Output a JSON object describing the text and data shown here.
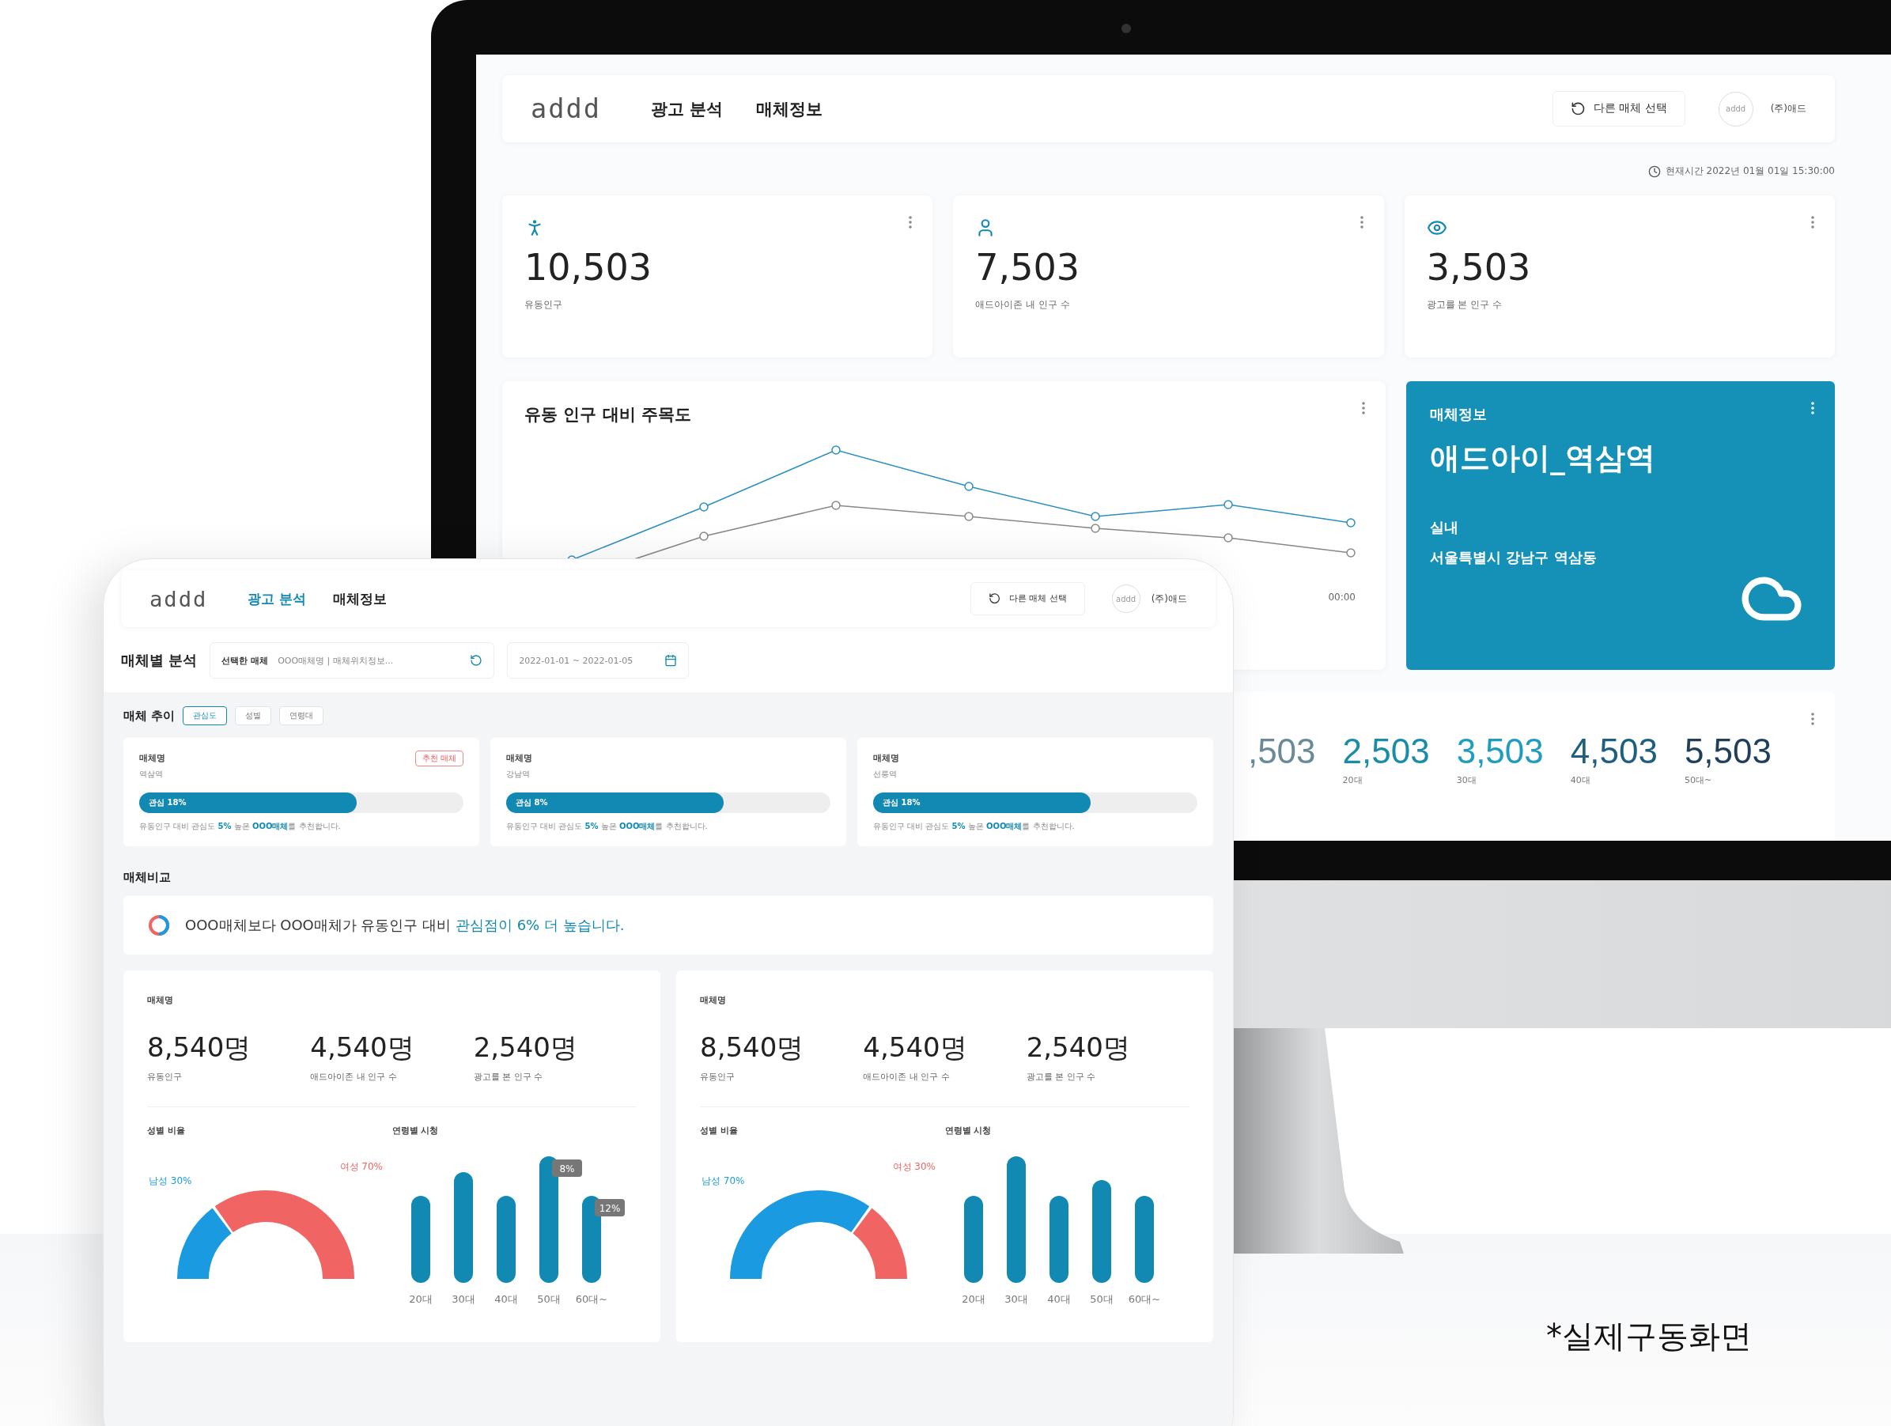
{
  "monitor": {
    "header": {
      "logo": "addd",
      "nav": [
        {
          "label": "광고 분석",
          "selected": false
        },
        {
          "label": "매체정보",
          "selected": false
        }
      ],
      "switch_button": "다른 매체 선택",
      "avatar": "addd",
      "company": "(주)애드"
    },
    "current_time": "현재시간 2022년 01월 01일 15:30:00",
    "stats": [
      {
        "kind": "walk",
        "value": "10,503",
        "label": "유동인구"
      },
      {
        "kind": "person",
        "value": "7,503",
        "label": "애드아이존 내 인구 수"
      },
      {
        "kind": "eye",
        "value": "3,503",
        "label": "광고를 본 인구 수"
      }
    ],
    "attention_chart": {
      "title": "유동 인구 대비 주목도",
      "x_label": "00:00"
    },
    "media_info": {
      "heading": "매체정보",
      "name": "애드아이_역삼역",
      "placement": "실내",
      "address": "서울특별시 강남구 역삼동"
    },
    "age_counts": [
      {
        "value": ",503"
      },
      {
        "value": "2,503",
        "label": "20대"
      },
      {
        "value": "3,503",
        "label": "30대"
      },
      {
        "value": "4,503",
        "label": "40대"
      },
      {
        "value": "5,503",
        "label": "50대~"
      }
    ]
  },
  "tablet": {
    "header": {
      "logo": "addd",
      "nav": [
        {
          "label": "광고 분석",
          "selected": true
        },
        {
          "label": "매체정보",
          "selected": false
        }
      ],
      "switch_button": "다른 매체 선택",
      "avatar": "addd",
      "company": "(주)애드"
    },
    "filter": {
      "title": "매체별 분석",
      "select_label": "선택한 매체",
      "select_value": "OOO매체명 | 매체위치정보...",
      "date_range": "2022-01-01 ~ 2022-01-05"
    },
    "trend": {
      "title": "매체 추이",
      "toggles": [
        {
          "label": "관심도",
          "selected": true
        },
        {
          "label": "성별",
          "selected": false
        },
        {
          "label": "연령대",
          "selected": false
        }
      ],
      "cards": [
        {
          "name": "매체명",
          "location": "역삼역",
          "badge": "추천 매체",
          "level": 0.67,
          "bar_label": "관심 18%",
          "note": "유동인구 대비 관심도 **5%** 높은 **OOO매체**를 추천합니다."
        },
        {
          "name": "매체명",
          "location": "강남역",
          "level": 0.67,
          "bar_label": "관심 8%",
          "note": "유동인구 대비 관심도 **5%** 높은 **OOO매체**를 추천합니다."
        },
        {
          "name": "매체명",
          "location": "선릉역",
          "level": 0.67,
          "bar_label": "관심 18%",
          "note": "유동인구 대비 관심도 **5%** 높은 **OOO매체**를 추천합니다."
        }
      ]
    },
    "compare": {
      "title": "매체비교",
      "summary": "OOO매체보다 OOO매체가 유동인구 대비 ",
      "summary_highlight": "관심점이 6% 더 높습니다.",
      "cards": [
        {
          "name": "매체명",
          "stats": [
            {
              "value": "8,540명",
              "label": "유동인구"
            },
            {
              "value": "4,540명",
              "label": "애드아이존 내 인구 수"
            },
            {
              "value": "2,540명",
              "label": "광고를 본 인구 수"
            }
          ],
          "gender": {
            "title": "성별 비율",
            "segments": [
              {
                "label": "남성 30%",
                "color": "#1a9ae0"
              },
              {
                "label": "여성 70%",
                "color": "#f06464"
              }
            ]
          },
          "age": {
            "title": "연령별 시청",
            "bars": [
              {
                "label": "20대"
              },
              {
                "label": "30대"
              },
              {
                "label": "40대"
              },
              {
                "label": "50대",
                "tooltip": "8%"
              },
              {
                "label": "60대~",
                "tooltip": "12%"
              }
            ]
          }
        },
        {
          "name": "매체명",
          "stats": [
            {
              "value": "8,540명",
              "label": "유동인구"
            },
            {
              "value": "4,540명",
              "label": "애드아이존 내 인구 수"
            },
            {
              "value": "2,540명",
              "label": "광고를 본 인구 수"
            }
          ],
          "gender": {
            "title": "성별 비율",
            "segments": [
              {
                "label": "남성 70%",
                "color": "#1a9ae0"
              },
              {
                "label": "여성 30%",
                "color": "#f06464"
              }
            ]
          },
          "age": {
            "title": "연령별 시청",
            "bars": [
              {
                "label": "20대"
              },
              {
                "label": "30대"
              },
              {
                "label": "40대"
              },
              {
                "label": "50대"
              },
              {
                "label": "60대~"
              }
            ]
          }
        }
      ]
    }
  },
  "caption": "*실제구동화면"
}
